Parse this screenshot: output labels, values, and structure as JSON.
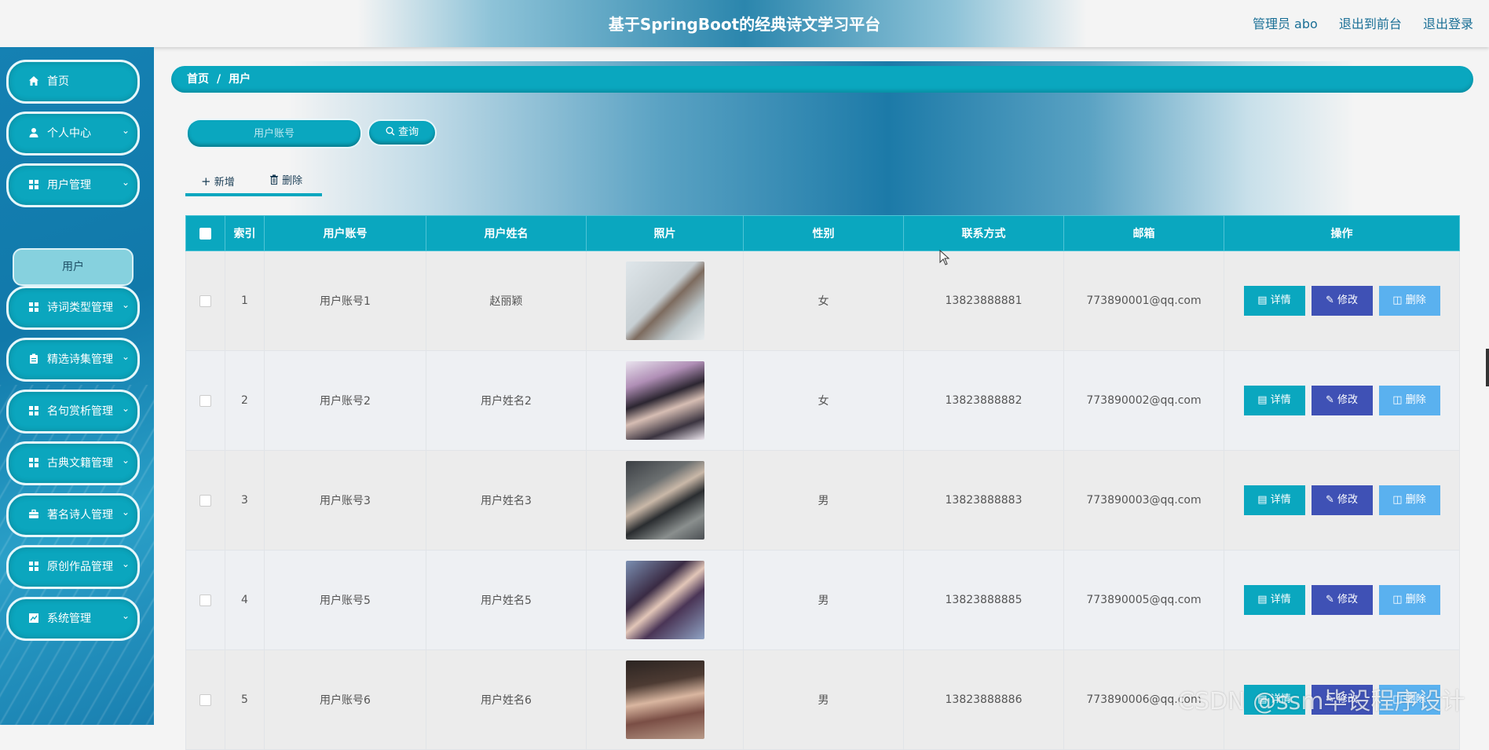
{
  "header": {
    "title": "基于SpringBoot的经典诗文学习平台",
    "admin_label": "管理员 abo",
    "to_front": "退出到前台",
    "logout": "退出登录"
  },
  "sidebar": {
    "items": [
      {
        "label": "首页",
        "icon": "home-icon"
      },
      {
        "label": "个人中心",
        "icon": "user-icon"
      },
      {
        "label": "用户管理",
        "icon": "grid-icon"
      },
      {
        "label": "诗词类型管理",
        "icon": "grid-icon"
      },
      {
        "label": "精选诗集管理",
        "icon": "clipboard-icon"
      },
      {
        "label": "名句赏析管理",
        "icon": "grid-icon"
      },
      {
        "label": "古典文籍管理",
        "icon": "grid-icon"
      },
      {
        "label": "著名诗人管理",
        "icon": "briefcase-icon"
      },
      {
        "label": "原创作品管理",
        "icon": "grid-icon"
      },
      {
        "label": "系统管理",
        "icon": "chart-icon"
      }
    ],
    "active_sub": "用户"
  },
  "breadcrumb": {
    "home": "首页",
    "sep": "/",
    "current": "用户"
  },
  "search": {
    "placeholder": "用户账号",
    "button": "查询"
  },
  "toolbar": {
    "add": "新增",
    "delete": "删除"
  },
  "table": {
    "headers": [
      "索引",
      "用户账号",
      "用户姓名",
      "照片",
      "性别",
      "联系方式",
      "邮箱",
      "操作"
    ],
    "rows": [
      {
        "index": "1",
        "account": "用户账号1",
        "name": "赵丽颖",
        "gender": "女",
        "phone": "13823888881",
        "email": "773890001@qq.com"
      },
      {
        "index": "2",
        "account": "用户账号2",
        "name": "用户姓名2",
        "gender": "女",
        "phone": "13823888882",
        "email": "773890002@qq.com"
      },
      {
        "index": "3",
        "account": "用户账号3",
        "name": "用户姓名3",
        "gender": "男",
        "phone": "13823888883",
        "email": "773890003@qq.com"
      },
      {
        "index": "4",
        "account": "用户账号5",
        "name": "用户姓名5",
        "gender": "男",
        "phone": "13823888885",
        "email": "773890005@qq.com"
      },
      {
        "index": "5",
        "account": "用户账号6",
        "name": "用户姓名6",
        "gender": "男",
        "phone": "13823888886",
        "email": "773890006@qq.com"
      }
    ],
    "actions": {
      "detail": "详情",
      "edit": "修改",
      "delete": "删除"
    }
  },
  "watermark": "CSDN @ssm毕设程序设计",
  "colors": {
    "primary": "#0aa7bf",
    "edit": "#3f51b5",
    "delete": "#5ab1ef"
  }
}
